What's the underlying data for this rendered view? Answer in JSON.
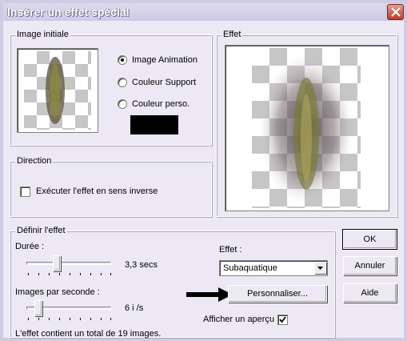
{
  "window": {
    "title": "Insérer un effet spécial"
  },
  "image_initiale": {
    "label": "Image initiale",
    "options": [
      "Image Animation",
      "Couleur Support",
      "Couleur perso."
    ],
    "selected": "Image Animation",
    "custom_color": "#000000"
  },
  "effet_preview": {
    "label": "Effet"
  },
  "direction": {
    "label": "Direction",
    "reverse_label": "Exécuter l'effet en sens inverse",
    "reverse_checked": false
  },
  "definir": {
    "label": "Définir l'effet",
    "duree_label": "Durée :",
    "duree_value": "3,3 secs",
    "images_label": "Images par seconde :",
    "images_value": "6 i /s",
    "effet_label": "Effet :",
    "effet_selected": "Subaquatique",
    "personnaliser_label": "Personnaliser...",
    "apercu_label": "Afficher un aperçu",
    "apercu_checked": true,
    "summary": "L'effet contient un total de 19 images."
  },
  "buttons": {
    "ok": "OK",
    "annuler": "Annuler",
    "aide": "Aide"
  },
  "colors": {
    "window_bg": "#ece9f4",
    "accent_arrow": "#000000"
  }
}
